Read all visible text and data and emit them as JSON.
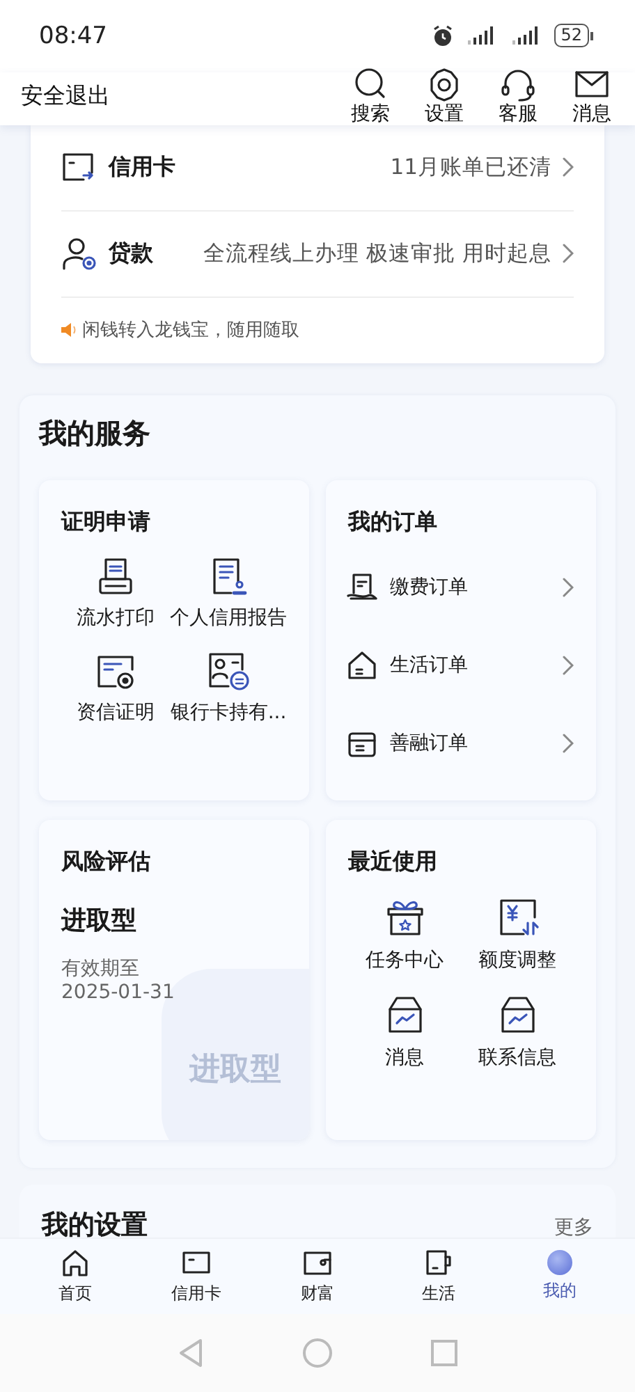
{
  "status_bar": {
    "time": "08:47",
    "battery": "52"
  },
  "header": {
    "logout": "安全退出",
    "actions": [
      "搜索",
      "设置",
      "客服",
      "消息"
    ]
  },
  "account_card": {
    "rows": [
      {
        "title": "信用卡",
        "detail": "11月账单已还清"
      },
      {
        "title": "贷款",
        "detail": "全流程线上办理 极速审批 用时起息"
      }
    ],
    "tip": "闲钱转入龙钱宝，随用随取"
  },
  "services": {
    "title": "我的服务",
    "certificates": {
      "title": "证明申请",
      "items": [
        "流水打印",
        "个人信用报告",
        "资信证明",
        "银行卡持有..."
      ]
    },
    "orders": {
      "title": "我的订单",
      "items": [
        "缴费订单",
        "生活订单",
        "善融订单"
      ]
    },
    "risk": {
      "title": "风险评估",
      "profile": "进取型",
      "validity_label": "有效期至",
      "validity_date": "2025-01-31",
      "badge": "进取型"
    },
    "recent": {
      "title": "最近使用",
      "items": [
        "任务中心",
        "额度调整",
        "消息",
        "联系信息"
      ]
    }
  },
  "settings": {
    "title": "我的设置",
    "more": "更多"
  },
  "tabs": [
    {
      "label": "首页",
      "selected": false
    },
    {
      "label": "信用卡",
      "selected": false
    },
    {
      "label": "财富",
      "selected": false
    },
    {
      "label": "生活",
      "selected": false
    },
    {
      "label": "我的",
      "selected": true
    }
  ]
}
